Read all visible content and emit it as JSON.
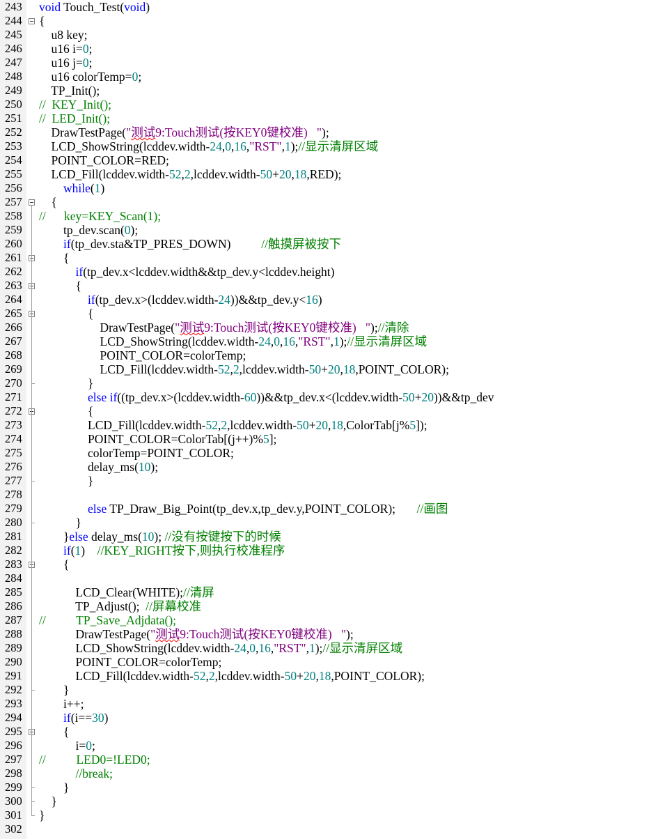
{
  "editor": {
    "language": "C",
    "lines": [
      {
        "n": "243",
        "fold": "",
        "segs": [
          [
            "kw",
            "void"
          ],
          [
            "t",
            " Touch_Test("
          ],
          [
            "kw",
            "void"
          ],
          [
            "t",
            ")"
          ]
        ]
      },
      {
        "n": "244",
        "fold": "start",
        "segs": [
          [
            "t",
            "{"
          ]
        ]
      },
      {
        "n": "245",
        "fold": "",
        "segs": [
          [
            "t",
            "    u8 key;"
          ]
        ]
      },
      {
        "n": "246",
        "fold": "",
        "segs": [
          [
            "t",
            "    u16 i="
          ],
          [
            "num",
            "0"
          ],
          [
            "t",
            ";"
          ]
        ]
      },
      {
        "n": "247",
        "fold": "",
        "segs": [
          [
            "t",
            "    u16 j="
          ],
          [
            "num",
            "0"
          ],
          [
            "t",
            ";"
          ]
        ]
      },
      {
        "n": "248",
        "fold": "",
        "segs": [
          [
            "t",
            "    u16 colorTemp="
          ],
          [
            "num",
            "0"
          ],
          [
            "t",
            ";"
          ]
        ]
      },
      {
        "n": "249",
        "fold": "",
        "segs": [
          [
            "t",
            "    TP_Init();"
          ]
        ]
      },
      {
        "n": "250",
        "fold": "",
        "segs": [
          [
            "cm",
            "//  KEY_Init();"
          ]
        ]
      },
      {
        "n": "251",
        "fold": "",
        "segs": [
          [
            "cm",
            "//  LED_Init();"
          ]
        ]
      },
      {
        "n": "252",
        "fold": "",
        "segs": [
          [
            "t",
            "    DrawTestPage("
          ],
          [
            "cnstr",
            "\""
          ],
          [
            "cnstr sq",
            "测试"
          ],
          [
            "cnstr",
            "9:Touch测试(按KEY0键校准)   \""
          ],
          [
            "t",
            ");"
          ]
        ]
      },
      {
        "n": "253",
        "fold": "",
        "segs": [
          [
            "t",
            "    LCD_ShowString(lcddev.width-"
          ],
          [
            "num",
            "24"
          ],
          [
            "t",
            ","
          ],
          [
            "num",
            "0"
          ],
          [
            "t",
            ","
          ],
          [
            "num",
            "16"
          ],
          [
            "t",
            ","
          ],
          [
            "cnstr",
            "\"RST\""
          ],
          [
            "t",
            ","
          ],
          [
            "num",
            "1"
          ],
          [
            "t",
            ");"
          ],
          [
            "cm",
            "//显示清屏区域"
          ]
        ]
      },
      {
        "n": "254",
        "fold": "",
        "segs": [
          [
            "t",
            "    POINT_COLOR=RED;"
          ]
        ]
      },
      {
        "n": "255",
        "fold": "",
        "segs": [
          [
            "t",
            "    LCD_Fill(lcddev.width-"
          ],
          [
            "num",
            "52"
          ],
          [
            "t",
            ","
          ],
          [
            "num",
            "2"
          ],
          [
            "t",
            ",lcddev.width-"
          ],
          [
            "num",
            "50"
          ],
          [
            "t",
            "+"
          ],
          [
            "num",
            "20"
          ],
          [
            "t",
            ","
          ],
          [
            "num",
            "18"
          ],
          [
            "t",
            ",RED);"
          ]
        ]
      },
      {
        "n": "256",
        "fold": "",
        "segs": [
          [
            "t",
            "        "
          ],
          [
            "kw",
            "while"
          ],
          [
            "t",
            "("
          ],
          [
            "num",
            "1"
          ],
          [
            "t",
            ")"
          ]
        ]
      },
      {
        "n": "257",
        "fold": "start",
        "segs": [
          [
            "t",
            "    {"
          ]
        ]
      },
      {
        "n": "258",
        "fold": "",
        "segs": [
          [
            "cm",
            "//      key=KEY_Scan(1);"
          ]
        ]
      },
      {
        "n": "259",
        "fold": "",
        "segs": [
          [
            "t",
            "        tp_dev.scan("
          ],
          [
            "num",
            "0"
          ],
          [
            "t",
            ");"
          ]
        ]
      },
      {
        "n": "260",
        "fold": "",
        "segs": [
          [
            "t",
            "        "
          ],
          [
            "kw",
            "if"
          ],
          [
            "t",
            "(tp_dev.sta&TP_PRES_DOWN)          "
          ],
          [
            "cm",
            "//触摸屏被按下"
          ]
        ]
      },
      {
        "n": "261",
        "fold": "start",
        "segs": [
          [
            "t",
            "        {"
          ]
        ]
      },
      {
        "n": "262",
        "fold": "",
        "segs": [
          [
            "t",
            "            "
          ],
          [
            "kw",
            "if"
          ],
          [
            "t",
            "(tp_dev.x<lcddev.width&&tp_dev.y<lcddev.height)"
          ]
        ]
      },
      {
        "n": "263",
        "fold": "start",
        "segs": [
          [
            "t",
            "            {"
          ]
        ]
      },
      {
        "n": "264",
        "fold": "",
        "segs": [
          [
            "t",
            "                "
          ],
          [
            "kw",
            "if"
          ],
          [
            "t",
            "(tp_dev.x>(lcddev.width-"
          ],
          [
            "num",
            "24"
          ],
          [
            "t",
            "))&&tp_dev.y<"
          ],
          [
            "num",
            "16"
          ],
          [
            "t",
            ")"
          ]
        ]
      },
      {
        "n": "265",
        "fold": "start",
        "segs": [
          [
            "t",
            "                {"
          ]
        ]
      },
      {
        "n": "266",
        "fold": "",
        "segs": [
          [
            "t",
            "                    DrawTestPage("
          ],
          [
            "cnstr",
            "\""
          ],
          [
            "cnstr sq",
            "测试"
          ],
          [
            "cnstr",
            "9:Touch测试(按KEY0键校准)   \""
          ],
          [
            "t",
            ");"
          ],
          [
            "cm",
            "//清除"
          ]
        ]
      },
      {
        "n": "267",
        "fold": "",
        "segs": [
          [
            "t",
            "                    LCD_ShowString(lcddev.width-"
          ],
          [
            "num",
            "24"
          ],
          [
            "t",
            ","
          ],
          [
            "num",
            "0"
          ],
          [
            "t",
            ","
          ],
          [
            "num",
            "16"
          ],
          [
            "t",
            ","
          ],
          [
            "cnstr",
            "\"RST\""
          ],
          [
            "t",
            ","
          ],
          [
            "num",
            "1"
          ],
          [
            "t",
            ");"
          ],
          [
            "cm",
            "//显示清屏区域"
          ]
        ]
      },
      {
        "n": "268",
        "fold": "",
        "segs": [
          [
            "t",
            "                    POINT_COLOR=colorTemp;"
          ]
        ]
      },
      {
        "n": "269",
        "fold": "",
        "segs": [
          [
            "t",
            "                    LCD_Fill(lcddev.width-"
          ],
          [
            "num",
            "52"
          ],
          [
            "t",
            ","
          ],
          [
            "num",
            "2"
          ],
          [
            "t",
            ",lcddev.width-"
          ],
          [
            "num",
            "50"
          ],
          [
            "t",
            "+"
          ],
          [
            "num",
            "20"
          ],
          [
            "t",
            ","
          ],
          [
            "num",
            "18"
          ],
          [
            "t",
            ",POINT_COLOR);"
          ]
        ]
      },
      {
        "n": "270",
        "fold": "end",
        "segs": [
          [
            "t",
            "                }"
          ]
        ]
      },
      {
        "n": "271",
        "fold": "",
        "segs": [
          [
            "t",
            "                "
          ],
          [
            "kw",
            "else if"
          ],
          [
            "t",
            "((tp_dev.x>(lcddev.width-"
          ],
          [
            "num",
            "60"
          ],
          [
            "t",
            "))&&tp_dev.x<(lcddev.width-"
          ],
          [
            "num",
            "50"
          ],
          [
            "t",
            "+"
          ],
          [
            "num",
            "20"
          ],
          [
            "t",
            "))&&tp_dev"
          ]
        ]
      },
      {
        "n": "272",
        "fold": "start",
        "segs": [
          [
            "t",
            "                {"
          ]
        ]
      },
      {
        "n": "273",
        "fold": "",
        "segs": [
          [
            "t",
            "                LCD_Fill(lcddev.width-"
          ],
          [
            "num",
            "52"
          ],
          [
            "t",
            ","
          ],
          [
            "num",
            "2"
          ],
          [
            "t",
            ",lcddev.width-"
          ],
          [
            "num",
            "50"
          ],
          [
            "t",
            "+"
          ],
          [
            "num",
            "20"
          ],
          [
            "t",
            ","
          ],
          [
            "num",
            "18"
          ],
          [
            "t",
            ",ColorTab[j%"
          ],
          [
            "num",
            "5"
          ],
          [
            "t",
            "]);"
          ]
        ]
      },
      {
        "n": "274",
        "fold": "",
        "segs": [
          [
            "t",
            "                POINT_COLOR=ColorTab[(j++)%"
          ],
          [
            "num",
            "5"
          ],
          [
            "t",
            "];"
          ]
        ]
      },
      {
        "n": "275",
        "fold": "",
        "segs": [
          [
            "t",
            "                colorTemp=POINT_COLOR;"
          ]
        ]
      },
      {
        "n": "276",
        "fold": "",
        "segs": [
          [
            "t",
            "                delay_ms("
          ],
          [
            "num",
            "10"
          ],
          [
            "t",
            ");"
          ]
        ]
      },
      {
        "n": "277",
        "fold": "end",
        "segs": [
          [
            "t",
            "                }"
          ]
        ]
      },
      {
        "n": "278",
        "fold": "",
        "segs": [
          [
            "t",
            ""
          ]
        ]
      },
      {
        "n": "279",
        "fold": "",
        "segs": [
          [
            "t",
            "                "
          ],
          [
            "kw",
            "else"
          ],
          [
            "t",
            " TP_Draw_Big_Point(tp_dev.x,tp_dev.y,POINT_COLOR);       "
          ],
          [
            "cm",
            "//画图"
          ]
        ]
      },
      {
        "n": "280",
        "fold": "end",
        "segs": [
          [
            "t",
            "            }"
          ]
        ]
      },
      {
        "n": "281",
        "fold": "",
        "segs": [
          [
            "t",
            "        }"
          ],
          [
            "kw",
            "else"
          ],
          [
            "t",
            " delay_ms("
          ],
          [
            "num",
            "10"
          ],
          [
            "t",
            "); "
          ],
          [
            "cm",
            "//没有按键按下的时候"
          ]
        ]
      },
      {
        "n": "282",
        "fold": "",
        "segs": [
          [
            "t",
            "        "
          ],
          [
            "kw",
            "if"
          ],
          [
            "t",
            "("
          ],
          [
            "num",
            "1"
          ],
          [
            "t",
            ")    "
          ],
          [
            "cm",
            "//KEY_RIGHT按下,则执行校准程序"
          ]
        ]
      },
      {
        "n": "283",
        "fold": "start",
        "segs": [
          [
            "t",
            "        {"
          ]
        ]
      },
      {
        "n": "284",
        "fold": "",
        "segs": [
          [
            "t",
            ""
          ]
        ]
      },
      {
        "n": "285",
        "fold": "",
        "segs": [
          [
            "t",
            "            LCD_Clear(WHITE);"
          ],
          [
            "cm",
            "//清屏"
          ]
        ]
      },
      {
        "n": "286",
        "fold": "",
        "segs": [
          [
            "t",
            "            TP_Adjust();  "
          ],
          [
            "cm",
            "//屏幕校准"
          ]
        ]
      },
      {
        "n": "287",
        "fold": "",
        "segs": [
          [
            "cm",
            "//          TP_Save_Adjdata();"
          ]
        ]
      },
      {
        "n": "288",
        "fold": "",
        "segs": [
          [
            "t",
            "            DrawTestPage("
          ],
          [
            "cnstr",
            "\""
          ],
          [
            "cnstr sq",
            "测试"
          ],
          [
            "cnstr",
            "9:Touch测试(按KEY0键校准)   \""
          ],
          [
            "t",
            ");"
          ]
        ]
      },
      {
        "n": "289",
        "fold": "",
        "segs": [
          [
            "t",
            "            LCD_ShowString(lcddev.width-"
          ],
          [
            "num",
            "24"
          ],
          [
            "t",
            ","
          ],
          [
            "num",
            "0"
          ],
          [
            "t",
            ","
          ],
          [
            "num",
            "16"
          ],
          [
            "t",
            ","
          ],
          [
            "cnstr",
            "\"RST\""
          ],
          [
            "t",
            ","
          ],
          [
            "num",
            "1"
          ],
          [
            "t",
            ");"
          ],
          [
            "cm",
            "//显示清屏区域"
          ]
        ]
      },
      {
        "n": "290",
        "fold": "",
        "segs": [
          [
            "t",
            "            POINT_COLOR=colorTemp;"
          ]
        ]
      },
      {
        "n": "291",
        "fold": "",
        "segs": [
          [
            "t",
            "            LCD_Fill(lcddev.width-"
          ],
          [
            "num",
            "52"
          ],
          [
            "t",
            ","
          ],
          [
            "num",
            "2"
          ],
          [
            "t",
            ",lcddev.width-"
          ],
          [
            "num",
            "50"
          ],
          [
            "t",
            "+"
          ],
          [
            "num",
            "20"
          ],
          [
            "t",
            ","
          ],
          [
            "num",
            "18"
          ],
          [
            "t",
            ",POINT_COLOR);"
          ]
        ]
      },
      {
        "n": "292",
        "fold": "end",
        "segs": [
          [
            "t",
            "        }"
          ]
        ]
      },
      {
        "n": "293",
        "fold": "",
        "segs": [
          [
            "t",
            "        i++;"
          ]
        ]
      },
      {
        "n": "294",
        "fold": "",
        "segs": [
          [
            "t",
            "        "
          ],
          [
            "kw",
            "if"
          ],
          [
            "t",
            "(i=="
          ],
          [
            "num",
            "30"
          ],
          [
            "t",
            ")"
          ]
        ]
      },
      {
        "n": "295",
        "fold": "start",
        "segs": [
          [
            "t",
            "        {"
          ]
        ]
      },
      {
        "n": "296",
        "fold": "",
        "segs": [
          [
            "t",
            "            i="
          ],
          [
            "num",
            "0"
          ],
          [
            "t",
            ";"
          ]
        ]
      },
      {
        "n": "297",
        "fold": "",
        "segs": [
          [
            "cm",
            "//          LED0=!LED0;"
          ]
        ]
      },
      {
        "n": "298",
        "fold": "",
        "segs": [
          [
            "t",
            "            "
          ],
          [
            "cm",
            "//break;"
          ]
        ]
      },
      {
        "n": "299",
        "fold": "end",
        "segs": [
          [
            "t",
            "        }"
          ]
        ]
      },
      {
        "n": "300",
        "fold": "end",
        "segs": [
          [
            "t",
            "    }"
          ]
        ]
      },
      {
        "n": "301",
        "fold": "end",
        "segs": [
          [
            "t",
            "}"
          ]
        ]
      },
      {
        "n": "302",
        "fold": "",
        "segs": [
          [
            "t",
            ""
          ]
        ]
      }
    ]
  },
  "colors": {
    "keyword": "#0000ff",
    "number": "#008080",
    "comment": "#008000",
    "string": "#800080",
    "gutter_bg": "#f2f2f2"
  }
}
